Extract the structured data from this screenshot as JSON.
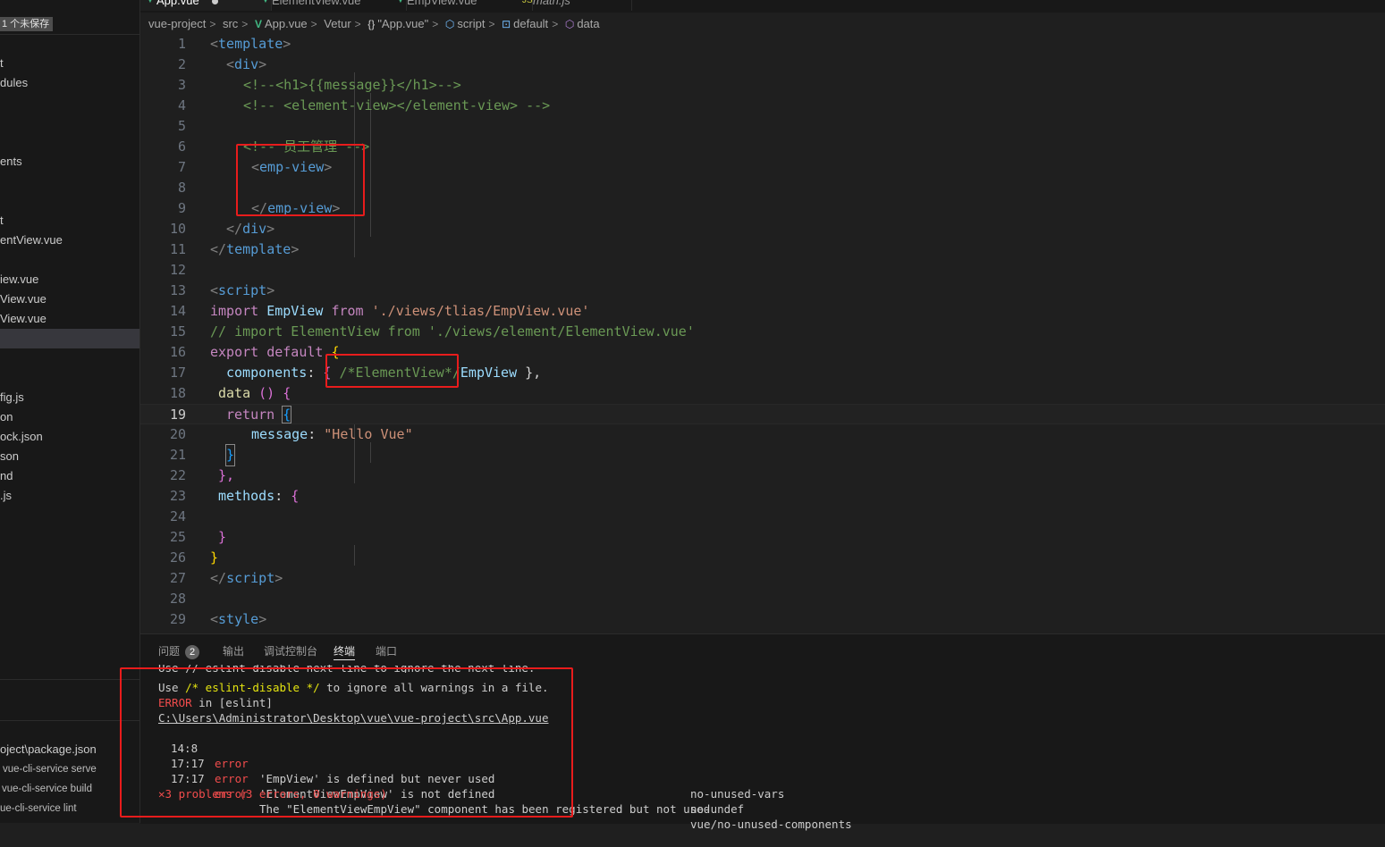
{
  "sidebar": {
    "unsaved_label": "1 个未保存",
    "items": [
      {
        "label": "t"
      },
      {
        "label": "dules"
      },
      {
        "label": "ents"
      },
      {
        "label": "t"
      },
      {
        "label": "entView.vue"
      },
      {
        "label": "iew.vue"
      },
      {
        "label": "View.vue"
      },
      {
        "label": "View.vue"
      },
      {
        "label": ""
      },
      {
        "label": "fig.js"
      },
      {
        "label": "on"
      },
      {
        "label": "ock.json"
      },
      {
        "label": "son"
      },
      {
        "label": "nd"
      },
      {
        "label": ".js"
      }
    ],
    "npm_scripts": [
      {
        "label": "oject\\package.json"
      },
      {
        "label": "vue-cli-service serve"
      },
      {
        "label": "vue-cli-service build"
      },
      {
        "label": "ue-cli-service lint"
      }
    ]
  },
  "tabs": [
    {
      "label": "App.vue",
      "active": true,
      "modified": true
    },
    {
      "label": "ElementView.vue",
      "active": false
    },
    {
      "label": "EmpView.vue",
      "active": false
    },
    {
      "label": "math.js",
      "active": false
    }
  ],
  "breadcrumb": {
    "items": [
      "vue-project",
      "src",
      "App.vue",
      "Vetur",
      "\"App.vue\"",
      "script",
      "default",
      "data"
    ],
    "icons": [
      "",
      "",
      "vue-icon",
      "",
      "braces-icon",
      "cube-outline-icon",
      "field-icon",
      "cube-icon"
    ]
  },
  "editor": {
    "current_line": 19,
    "line_numbers": [
      "1",
      "2",
      "3",
      "4",
      "5",
      "6",
      "7",
      "8",
      "9",
      "10",
      "11",
      "12",
      "13",
      "14",
      "15",
      "16",
      "17",
      "18",
      "19",
      "20",
      "21",
      "22",
      "23",
      "24",
      "25",
      "26",
      "27",
      "28",
      "29"
    ],
    "code": {
      "l1a": "<",
      "l1b": "template",
      "l1c": ">",
      "l2a": "<",
      "l2b": "div",
      "l2c": ">",
      "l3": "<!--<h1>{{message}}</h1>-->",
      "l4": "<!-- <element-view></element-view> -->",
      "l6": "<!-- 员工管理 -->",
      "l7a": "<",
      "l7b": "emp-view",
      "l7c": ">",
      "l9a": "</",
      "l9b": "emp-view",
      "l9c": ">",
      "l10a": "</",
      "l10b": "div",
      "l10c": ">",
      "l11a": "</",
      "l11b": "template",
      "l11c": ">",
      "l13a": "<",
      "l13b": "script",
      "l13c": ">",
      "l14a": "import",
      "l14b": "EmpView",
      "l14c": "from",
      "l14d": "'./views/tlias/EmpView.vue'",
      "l15": "// import ElementView from './views/element/ElementView.vue'",
      "l16a": "export",
      "l16b": "default",
      "l16c": "{",
      "l17a": "components",
      "l17b": ":",
      "l17c": "{",
      "l17d": "/*ElementView*/",
      "l17e": "EmpView",
      "l17f": "},",
      "l18a": "data",
      "l18b": "()",
      "l18c": "{",
      "l19a": "return",
      "l19b": "{",
      "l20a": "message",
      "l20b": ":",
      "l20c": "\"Hello Vue\"",
      "l21": "}",
      "l22": "},",
      "l23a": "methods",
      "l23b": ":",
      "l23c": "{",
      "l25": "}",
      "l26": "}",
      "l27a": "</",
      "l27b": "script",
      "l27c": ">",
      "l29a": "<",
      "l29b": "style",
      "l29c": ">"
    }
  },
  "panel": {
    "tabs": [
      "问题",
      "输出",
      "调试控制台",
      "终端",
      "端口"
    ],
    "problems_count": "2",
    "active_tab": "终端",
    "terminal": {
      "line1": "Use // eslint-disable-next-line to ignore the next line.",
      "line2a": "Use ",
      "line2b": "/* eslint-disable */",
      "line2c": " to ignore all warnings in a file.",
      "line3a": "ERROR",
      "line3b": " in [eslint]",
      "line4": "C:\\Users\\Administrator\\Desktop\\vue\\vue-project\\src\\App.vue",
      "errors": [
        {
          "pos": "14:8",
          "level": "error",
          "msg": "'EmpView' is defined but never used",
          "rule": "no-unused-vars"
        },
        {
          "pos": "17:17",
          "level": "error",
          "msg": "'ElementViewEmpView' is not defined",
          "rule": "no-undef"
        },
        {
          "pos": "17:17",
          "level": "error",
          "msg": "The \"ElementViewEmpView\" component has been registered but not used",
          "rule": "vue/no-unused-components"
        }
      ],
      "summary": "3 problems (3 errors, 0 warnings)"
    }
  },
  "colors": {
    "annotation_red": "#e81c1c",
    "editor_bg": "#1f1f1f",
    "sidebar_bg": "#181818",
    "error_red": "#f14c4c"
  }
}
